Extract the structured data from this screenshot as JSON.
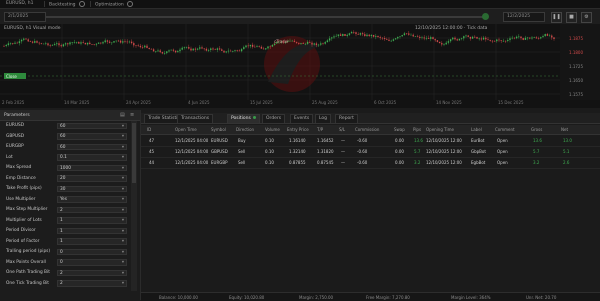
{
  "tabs": [
    {
      "label": "EURUSD, h1"
    },
    {
      "label": "Backtesting"
    },
    {
      "label": "Optimization"
    }
  ],
  "toolbar": {
    "start_date": "2/1/2025",
    "end_date": "12/2/2025",
    "pause_icon": "pause-icon",
    "stop_icon": "stop-icon",
    "settings_icon": "gear-icon"
  },
  "chart": {
    "title": "EURUSD, h1 Visual mode",
    "info": "12/10/2025 12:00:00 · Tick data",
    "x_ticks": [
      "2 Feb 2025",
      "14 Mar 2025",
      "24 Apr 2025",
      "4 Jun 2025",
      "15 Jul 2025",
      "25 Aug 2025",
      "6 Oct 2025",
      "14 Nov 2025",
      "15 Dec 2025"
    ],
    "y_ticks": [
      "1.1875",
      "1.1800",
      "1.1725",
      "1.1650",
      "1.1575"
    ],
    "tag": "Close",
    "watermark": "cTrader"
  },
  "params": {
    "header": "Parameters",
    "rows": [
      {
        "label": "EURUSD",
        "value": "60"
      },
      {
        "label": "GBPUSD",
        "value": "60"
      },
      {
        "label": "EURGBP",
        "value": "60"
      },
      {
        "label": "Lot",
        "value": "0.1"
      },
      {
        "label": "Max Spread",
        "value": "1000"
      },
      {
        "label": "Emp Distance",
        "value": "20"
      },
      {
        "label": "Take Profit (pips)",
        "value": "30"
      },
      {
        "label": "Use Multiplier",
        "value": "Yes"
      },
      {
        "label": "Max Step Multiplier",
        "value": "2"
      },
      {
        "label": "Multiplier of Lots",
        "value": "1"
      },
      {
        "label": "Period Divisor",
        "value": "1"
      },
      {
        "label": "Period of Factor",
        "value": "1"
      },
      {
        "label": "Tralling period (pips)",
        "value": "0"
      },
      {
        "label": "Max Points Overall",
        "value": "0"
      },
      {
        "label": "One Path Trading Bit",
        "value": "2"
      },
      {
        "label": "One Tick Trading Bit",
        "value": "2"
      }
    ]
  },
  "positions_tabs": [
    {
      "label": "Trade Statistics"
    },
    {
      "label": "Transactions"
    },
    {
      "label": "Positions"
    },
    {
      "label": "Orders"
    },
    {
      "label": "Events"
    },
    {
      "label": "Log"
    },
    {
      "label": "Report"
    }
  ],
  "table": {
    "headers": [
      "ID",
      "Open Time",
      "Symbol",
      "Direction",
      "Volume",
      "Entry Price",
      "T/P",
      "S/L",
      "Commission",
      "Swap",
      "Pips",
      "Opening Time",
      "Label",
      "Comment",
      "Gross",
      "Net"
    ],
    "rows": [
      {
        "id": "47",
        "time": "12/1/2025 04:00",
        "symbol": "EURUSD",
        "dir": "Buy",
        "vol": "0.10",
        "entry": "1.16140",
        "tp": "1.16452",
        "sl": "—",
        "comm": "-0.60",
        "swap": "0.00",
        "pips": "13.6",
        "opentime": "12/10/2025 12:00",
        "label": "EurBot",
        "comment": "Open",
        "gross": "13.6",
        "net": "13.0"
      },
      {
        "id": "45",
        "time": "12/1/2025 04:00",
        "symbol": "GBPUSD",
        "dir": "Sell",
        "vol": "0.10",
        "entry": "1.32140",
        "tp": "1.31820",
        "sl": "—",
        "comm": "-0.60",
        "swap": "0.00",
        "pips": "5.7",
        "opentime": "12/10/2025 12:00",
        "label": "GbpBot",
        "comment": "Open",
        "gross": "5.7",
        "net": "5.1"
      },
      {
        "id": "44",
        "time": "12/1/2025 04:00",
        "symbol": "EURGBP",
        "dir": "Sell",
        "vol": "0.10",
        "entry": "0.87855",
        "tp": "0.87545",
        "sl": "—",
        "comm": "-0.60",
        "swap": "0.00",
        "pips": "3.2",
        "opentime": "12/10/2025 12:00",
        "label": "EgbBot",
        "comment": "Open",
        "gross": "3.2",
        "net": "2.6"
      }
    ]
  },
  "status": [
    {
      "label": "Balance: 10,000.00"
    },
    {
      "label": "Equity: 10,020.80"
    },
    {
      "label": "Margin: 2,750.00"
    },
    {
      "label": "Free Margin: 7,270.80"
    },
    {
      "label": "Margin Level: 364%"
    },
    {
      "label": "Unr. Net: 20.70"
    }
  ]
}
